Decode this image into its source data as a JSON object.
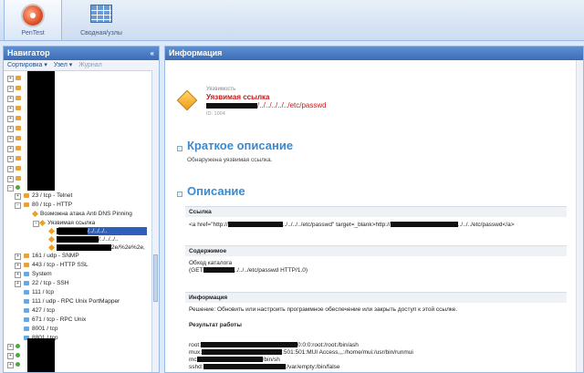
{
  "tabs": [
    {
      "label": "PenTest",
      "icon": "pentest-icon",
      "active": true
    },
    {
      "label": "Сводная/узлы",
      "icon": "grid-icon",
      "active": false
    }
  ],
  "navigator": {
    "title": "Навигатор",
    "toolbar": {
      "sort": "Сортировка ▾",
      "node": "Узел ▾",
      "journal": "Журнал"
    },
    "tree": [
      {
        "label": "23 / tcp - Telnet"
      },
      {
        "label": "80 / tcp - HTTP"
      },
      {
        "label": "Возможна атака Anti DNS Pinning"
      },
      {
        "label": "Уязвимая ссылка"
      },
      {
        "label": "/../../../.."
      },
      {
        "label": "/../../../.."
      },
      {
        "label": "2e/%2e%2e,"
      },
      {
        "label": "161 / udp - SNMP"
      },
      {
        "label": "443 / tcp - HTTP SSL"
      },
      {
        "label": "System"
      },
      {
        "label": "22 / tcp - SSH"
      },
      {
        "label": "111 / tcp"
      },
      {
        "label": "111 / udp - RPC Unix PortMapper"
      },
      {
        "label": "427 / tcp"
      },
      {
        "label": "671 / tcp - RPC Unix"
      },
      {
        "label": "8001 / tcp"
      },
      {
        "label": "8801 / tcp"
      }
    ]
  },
  "info": {
    "title": "Информация",
    "vuln_type": "Уязвимость",
    "vuln_title": "Уязвимая ссылка",
    "vuln_path": "/../../../../../etc/passwd",
    "vuln_id": "ID: 1004",
    "short_title": "Краткое описание",
    "short_text": "Обнаружена уязвимая ссылка.",
    "desc_title": "Описание",
    "link_head": "Ссылка",
    "link_text_a": "<a href=\"http://",
    "link_text_b": "../../../../etc/passwd\" target=_blank>http://",
    "link_text_c": "../../../etc/passwd</a>",
    "content_head": "Содержимое",
    "content_line1": "Обход каталога",
    "content_line2_a": "(GET",
    "content_line2_b": "../../../etc/passwd HTTP/1.0)",
    "info_head": "Информация",
    "solution": "Решение: Обновить или настроить программное обеспечение или закрыть доступ к этой ссылке.",
    "result_head": "Результат работы",
    "result_lines": [
      "root:",
      "mux:",
      "mc",
      "sshd:"
    ],
    "result_tails": [
      "0:0:0:root:/root:/bin/ash",
      ":501:501:MUI Access,,,:/home/mui:/usr/bin/runmui",
      "/bin/sh",
      ":/var/empty:/bin/false"
    ]
  }
}
